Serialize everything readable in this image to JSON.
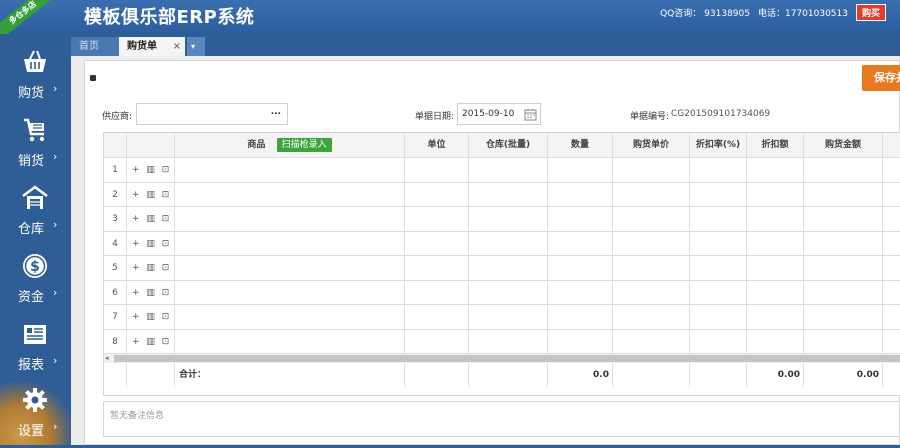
{
  "header": {
    "title": "模板俱乐部ERP系统",
    "qq": "QQ咨询： 93138905",
    "phone": "电话：17701030513",
    "buy_label": "购买",
    "ribbon_text": "多仓多店"
  },
  "sidebar": {
    "items": [
      {
        "label": "购货",
        "icon": "basket-icon"
      },
      {
        "label": "销货",
        "icon": "cart-icon"
      },
      {
        "label": "仓库",
        "icon": "warehouse-icon"
      },
      {
        "label": "资金",
        "icon": "dollar-icon"
      },
      {
        "label": "报表",
        "icon": "report-icon"
      },
      {
        "label": "设置",
        "icon": "gear-icon"
      }
    ],
    "arrow": "›"
  },
  "tabs": {
    "home": "首页",
    "purchase": "购货单",
    "close": "×",
    "menu": "▾"
  },
  "form": {
    "supplier_label": "供应商:",
    "supplier_value": "",
    "supplier_more": "...",
    "date_label": "单据日期:",
    "date_value": "2015-09-10",
    "bill_no_label": "单据编号:",
    "bill_no_value": "CG201509101734069",
    "save_label": "保存并"
  },
  "grid": {
    "columns": [
      "商品",
      "单位",
      "仓库(批量)",
      "数量",
      "购货单价",
      "折扣率(%)",
      "折扣额",
      "购货金额"
    ],
    "scan_label": "扫描枪录入",
    "rows": [
      "1",
      "2",
      "3",
      "4",
      "5",
      "6",
      "7",
      "8"
    ],
    "row_actions": "+ ▥ ⊡",
    "scroll_left": "◂",
    "totals": {
      "label": "合计：",
      "quantity": "0.0",
      "discount": "0.00",
      "amount": "0.00"
    }
  },
  "remark_placeholder": "暂无备注信息"
}
